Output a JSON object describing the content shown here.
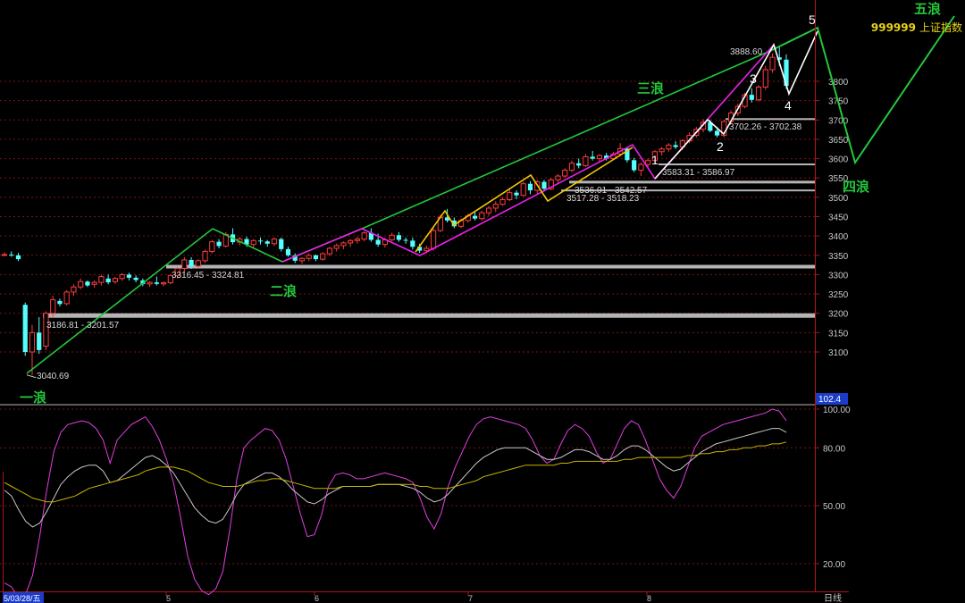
{
  "title": {
    "code": "999999",
    "name": "上证指数"
  },
  "period_label": "日线",
  "date_label": "5/03/28/五",
  "month_labels": [
    "5",
    "6",
    "7",
    "8"
  ],
  "oscillator_value": "102.4",
  "colors": {
    "background": "#000000",
    "up": "#ff3c3c",
    "down": "#54ffff",
    "green_wave": "#22c83c",
    "magenta_wave": "#ee20ee",
    "yellow_wave": "#f0c800",
    "white_wave": "#ffffff",
    "grid": "#7a1414",
    "ma_gold": "#c8b400",
    "ma_white": "#c8c8c8"
  },
  "chart_data": [
    {
      "type": "candlestick",
      "title": "",
      "y_ticks": [
        3100,
        3150,
        3200,
        3250,
        3300,
        3350,
        3400,
        3450,
        3500,
        3550,
        3600,
        3650,
        3700,
        3750,
        3800
      ],
      "ylim": [
        3010,
        3900
      ],
      "ohlc": [
        [
          3350,
          3358,
          3348,
          3352
        ],
        [
          3352,
          3360,
          3346,
          3350
        ],
        [
          3350,
          3356,
          3335,
          3340
        ],
        [
          3222,
          3228,
          3090,
          3100
        ],
        [
          3100,
          3170,
          3040,
          3150
        ],
        [
          3150,
          3190,
          3095,
          3105
        ],
        [
          3115,
          3205,
          3105,
          3200
        ],
        [
          3200,
          3245,
          3190,
          3235
        ],
        [
          3232,
          3238,
          3218,
          3224
        ],
        [
          3225,
          3260,
          3220,
          3255
        ],
        [
          3255,
          3275,
          3245,
          3268
        ],
        [
          3268,
          3290,
          3262,
          3282
        ],
        [
          3282,
          3285,
          3268,
          3272
        ],
        [
          3275,
          3285,
          3266,
          3280
        ],
        [
          3280,
          3300,
          3272,
          3295
        ],
        [
          3290,
          3300,
          3275,
          3280
        ],
        [
          3282,
          3294,
          3276,
          3290
        ],
        [
          3290,
          3304,
          3284,
          3300
        ],
        [
          3300,
          3305,
          3285,
          3292
        ],
        [
          3292,
          3298,
          3280,
          3286
        ],
        [
          3285,
          3290,
          3270,
          3276
        ],
        [
          3276,
          3283,
          3268,
          3280
        ],
        [
          3280,
          3295,
          3272,
          3276
        ],
        [
          3276,
          3282,
          3270,
          3279
        ],
        [
          3279,
          3300,
          3275,
          3298
        ],
        [
          3298,
          3320,
          3290,
          3316
        ],
        [
          3316,
          3345,
          3305,
          3338
        ],
        [
          3338,
          3345,
          3315,
          3322
        ],
        [
          3322,
          3340,
          3318,
          3336
        ],
        [
          3336,
          3365,
          3330,
          3360
        ],
        [
          3360,
          3390,
          3355,
          3385
        ],
        [
          3385,
          3392,
          3368,
          3374
        ],
        [
          3374,
          3410,
          3370,
          3404
        ],
        [
          3404,
          3420,
          3378,
          3384
        ],
        [
          3384,
          3398,
          3375,
          3392
        ],
        [
          3392,
          3398,
          3372,
          3378
        ],
        [
          3378,
          3392,
          3370,
          3388
        ],
        [
          3388,
          3396,
          3378,
          3386
        ],
        [
          3386,
          3390,
          3372,
          3380
        ],
        [
          3380,
          3396,
          3374,
          3392
        ],
        [
          3392,
          3396,
          3360,
          3366
        ],
        [
          3366,
          3372,
          3346,
          3350
        ],
        [
          3350,
          3355,
          3330,
          3336
        ],
        [
          3336,
          3345,
          3328,
          3342
        ],
        [
          3342,
          3355,
          3335,
          3350
        ],
        [
          3350,
          3352,
          3335,
          3340
        ],
        [
          3340,
          3358,
          3336,
          3354
        ],
        [
          3354,
          3372,
          3348,
          3368
        ],
        [
          3368,
          3380,
          3360,
          3375
        ],
        [
          3375,
          3386,
          3366,
          3382
        ],
        [
          3382,
          3392,
          3372,
          3388
        ],
        [
          3388,
          3398,
          3380,
          3392
        ],
        [
          3392,
          3412,
          3386,
          3408
        ],
        [
          3408,
          3420,
          3385,
          3390
        ],
        [
          3390,
          3406,
          3372,
          3378
        ],
        [
          3378,
          3395,
          3370,
          3390
        ],
        [
          3390,
          3408,
          3386,
          3402
        ],
        [
          3402,
          3410,
          3385,
          3390
        ],
        [
          3390,
          3396,
          3380,
          3388
        ],
        [
          3388,
          3396,
          3365,
          3372
        ],
        [
          3372,
          3380,
          3356,
          3362
        ],
        [
          3362,
          3375,
          3355,
          3368
        ],
        [
          3368,
          3420,
          3362,
          3414
        ],
        [
          3414,
          3455,
          3410,
          3448
        ],
        [
          3448,
          3470,
          3435,
          3440
        ],
        [
          3440,
          3448,
          3420,
          3425
        ],
        [
          3425,
          3445,
          3420,
          3440
        ],
        [
          3440,
          3458,
          3435,
          3452
        ],
        [
          3452,
          3462,
          3440,
          3445
        ],
        [
          3445,
          3465,
          3440,
          3460
        ],
        [
          3460,
          3478,
          3452,
          3472
        ],
        [
          3472,
          3490,
          3462,
          3482
        ],
        [
          3482,
          3500,
          3478,
          3494
        ],
        [
          3494,
          3520,
          3490,
          3512
        ],
        [
          3512,
          3518,
          3495,
          3505
        ],
        [
          3505,
          3540,
          3502,
          3535
        ],
        [
          3535,
          3542,
          3508,
          3518
        ],
        [
          3518,
          3545,
          3510,
          3540
        ],
        [
          3540,
          3545,
          3515,
          3522
        ],
        [
          3522,
          3550,
          3518,
          3545
        ],
        [
          3545,
          3560,
          3538,
          3555
        ],
        [
          3555,
          3575,
          3550,
          3570
        ],
        [
          3570,
          3595,
          3565,
          3588
        ],
        [
          3588,
          3600,
          3575,
          3582
        ],
        [
          3582,
          3612,
          3578,
          3605
        ],
        [
          3605,
          3620,
          3595,
          3600
        ],
        [
          3600,
          3612,
          3590,
          3608
        ],
        [
          3608,
          3615,
          3595,
          3600
        ],
        [
          3600,
          3618,
          3596,
          3612
        ],
        [
          3612,
          3640,
          3605,
          3626
        ],
        [
          3626,
          3630,
          3590,
          3596
        ],
        [
          3596,
          3602,
          3565,
          3570
        ],
        [
          3570,
          3590,
          3555,
          3585
        ],
        [
          3585,
          3600,
          3578,
          3595
        ],
        [
          3595,
          3622,
          3590,
          3618
        ],
        [
          3618,
          3630,
          3608,
          3625
        ],
        [
          3625,
          3640,
          3618,
          3635
        ],
        [
          3635,
          3645,
          3625,
          3630
        ],
        [
          3630,
          3650,
          3622,
          3646
        ],
        [
          3646,
          3668,
          3640,
          3660
        ],
        [
          3660,
          3682,
          3655,
          3676
        ],
        [
          3676,
          3702,
          3668,
          3694
        ],
        [
          3694,
          3700,
          3668,
          3672
        ],
        [
          3672,
          3682,
          3655,
          3660
        ],
        [
          3660,
          3700,
          3655,
          3696
        ],
        [
          3696,
          3725,
          3690,
          3718
        ],
        [
          3718,
          3742,
          3710,
          3735
        ],
        [
          3735,
          3770,
          3730,
          3765
        ],
        [
          3765,
          3782,
          3745,
          3752
        ],
        [
          3752,
          3790,
          3748,
          3785
        ],
        [
          3785,
          3840,
          3778,
          3830
        ],
        [
          3830,
          3872,
          3822,
          3862
        ],
        [
          3862,
          3888,
          3840,
          3856
        ],
        [
          3856,
          3870,
          3780,
          3788
        ]
      ],
      "support_labels": [
        "3888.60",
        "3702.26 - 3702.38",
        "3583.31 - 3586.97",
        "3536.01 - 3542.57",
        "3517.28 - 3518.23",
        "3316.45 - 3324.81",
        "3186.81 - 3201.57",
        "3040.69"
      ],
      "support_values": [
        3888.6,
        3702.32,
        3585.14,
        3539.29,
        3517.76,
        3320.63,
        3194.19,
        3040.69
      ],
      "wave_labels": [
        "一浪",
        "二浪",
        "三浪",
        "四浪",
        "五浪"
      ],
      "wave_numbers": [
        "1",
        "2",
        "3",
        "4",
        "5"
      ]
    },
    {
      "type": "line",
      "title": "",
      "y_ticks": [
        20.0,
        50.0,
        80.0,
        100.0
      ],
      "series_colors": [
        "#e040e0",
        "#c8c8c8",
        "#c8b400"
      ],
      "series": [
        {
          "values": [
            10,
            8,
            2,
            4,
            14,
            34,
            58,
            78,
            88,
            92,
            93,
            94,
            93,
            90,
            84,
            72,
            84,
            88,
            92,
            94,
            96,
            91,
            84,
            74,
            62,
            44,
            24,
            12,
            6,
            4,
            7,
            16,
            38,
            64,
            80,
            84,
            87,
            90,
            89,
            84,
            74,
            60,
            46,
            34,
            35,
            45,
            60,
            66,
            67,
            66,
            64,
            64,
            65,
            66,
            67,
            66,
            65,
            64,
            62,
            54,
            44,
            38,
            46,
            60,
            70,
            78,
            86,
            92,
            95,
            96,
            95,
            94,
            93,
            92,
            90,
            84,
            76,
            72,
            74,
            82,
            89,
            92,
            90,
            86,
            78,
            72,
            74,
            82,
            90,
            94,
            92,
            84,
            74,
            64,
            58,
            54,
            60,
            70,
            80,
            86,
            88,
            90,
            92,
            93,
            94,
            95,
            96,
            97,
            98,
            100,
            99,
            94
          ]
        },
        {
          "values": [
            58,
            55,
            48,
            42,
            39,
            41,
            47,
            54,
            61,
            65,
            68,
            70,
            71,
            71,
            68,
            62,
            63,
            66,
            69,
            72,
            75,
            76,
            74,
            71,
            67,
            61,
            55,
            49,
            45,
            42,
            41,
            43,
            49,
            56,
            61,
            63,
            65,
            67,
            67,
            65,
            62,
            58,
            55,
            52,
            51,
            53,
            56,
            58,
            60,
            60,
            60,
            60,
            60,
            61,
            61,
            61,
            61,
            60,
            59,
            57,
            54,
            52,
            53,
            56,
            60,
            64,
            68,
            72,
            75,
            77,
            79,
            80,
            80,
            80,
            80,
            78,
            76,
            74,
            74,
            75,
            77,
            79,
            79,
            78,
            76,
            74,
            74,
            76,
            79,
            81,
            81,
            79,
            76,
            73,
            70,
            68,
            69,
            72,
            75,
            78,
            80,
            82,
            83,
            84,
            85,
            86,
            87,
            88,
            89,
            90,
            90,
            88
          ]
        },
        {
          "values": [
            62,
            60,
            58,
            56,
            54,
            53,
            52,
            52,
            53,
            54,
            55,
            57,
            59,
            60,
            61,
            62,
            63,
            64,
            65,
            66,
            68,
            69,
            70,
            70,
            70,
            69,
            68,
            66,
            64,
            62,
            61,
            60,
            60,
            60,
            61,
            62,
            63,
            63,
            64,
            64,
            63,
            62,
            61,
            60,
            59,
            59,
            59,
            59,
            60,
            60,
            60,
            60,
            60,
            61,
            61,
            61,
            61,
            61,
            61,
            60,
            60,
            59,
            59,
            59,
            60,
            61,
            62,
            63,
            65,
            66,
            67,
            68,
            69,
            70,
            71,
            71,
            71,
            71,
            71,
            72,
            72,
            73,
            73,
            73,
            73,
            73,
            73,
            73,
            74,
            74,
            75,
            75,
            75,
            75,
            75,
            75,
            75,
            76,
            76,
            77,
            77,
            78,
            78,
            79,
            79,
            80,
            80,
            81,
            81,
            82,
            82,
            83
          ]
        }
      ]
    }
  ]
}
